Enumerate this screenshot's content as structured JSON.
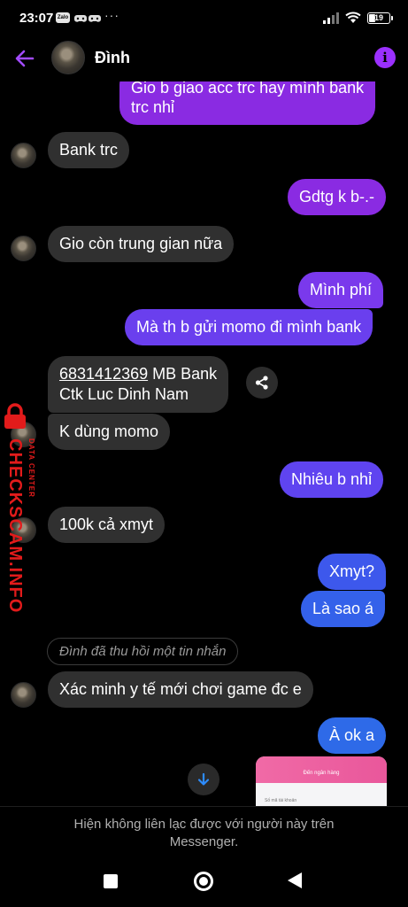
{
  "status_bar": {
    "time": "23:07",
    "notif_app": "Zalo",
    "more": "···",
    "battery": "19"
  },
  "header": {
    "contact_name": "Đình",
    "info_glyph": "i"
  },
  "colors": {
    "accent": "#8a2be2",
    "out_purple": "#8a2be2",
    "out_indigo": "#5f44f0",
    "out_blue": "#2e62e8",
    "incoming_bg": "#303030"
  },
  "messages": {
    "m1_line1": "Gio b giao acc trc hay mình bank",
    "m1_line2": "trc nhỉ",
    "m2": "Bank trc",
    "m3": "Gdtg k b-.-",
    "m4": "Gio còn trung gian nữa",
    "m5": "Mình phí",
    "m6": "Mà th b gửi momo đi mình bank",
    "m7_number": "6831412369",
    "m7_rest": " MB Bank",
    "m7_line2": "Ctk Luc Dinh Nam",
    "m8": "K dùng momo",
    "m9": "Nhiêu b nhỉ",
    "m10": "100k cả xmyt",
    "m11": "Xmyt?",
    "m12": "Là sao á",
    "m13_recalled": "Đình đã thu hồi một tin nhắn",
    "m14": "Xác minh y tế mới chơi game đc e",
    "m15": "À ok a"
  },
  "thumbnail": {
    "title": "Đến ngân hàng",
    "field": "Số mã tài khoản"
  },
  "watermark": {
    "main": "CHECKSCAM.INFO",
    "sub": "DATA CENTER"
  },
  "footer": {
    "line1": "Hiện không liên lạc được với người này trên",
    "line2": "Messenger."
  }
}
